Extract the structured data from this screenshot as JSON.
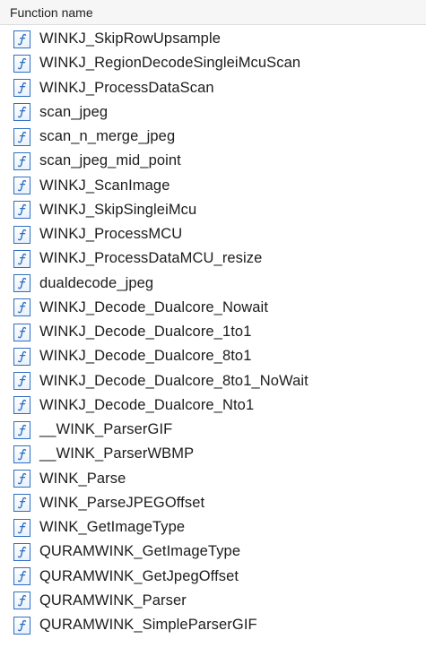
{
  "header": {
    "title": "Function name"
  },
  "functions": [
    {
      "name": "WINKJ_SkipRowUpsample"
    },
    {
      "name": "WINKJ_RegionDecodeSingleiMcuScan"
    },
    {
      "name": "WINKJ_ProcessDataScan"
    },
    {
      "name": "scan_jpeg"
    },
    {
      "name": "scan_n_merge_jpeg"
    },
    {
      "name": "scan_jpeg_mid_point"
    },
    {
      "name": "WINKJ_ScanImage"
    },
    {
      "name": "WINKJ_SkipSingleiMcu"
    },
    {
      "name": "WINKJ_ProcessMCU"
    },
    {
      "name": "WINKJ_ProcessDataMCU_resize"
    },
    {
      "name": "dualdecode_jpeg"
    },
    {
      "name": "WINKJ_Decode_Dualcore_Nowait"
    },
    {
      "name": "WINKJ_Decode_Dualcore_1to1"
    },
    {
      "name": "WINKJ_Decode_Dualcore_8to1"
    },
    {
      "name": "WINKJ_Decode_Dualcore_8to1_NoWait"
    },
    {
      "name": "WINKJ_Decode_Dualcore_Nto1"
    },
    {
      "name": "__WINK_ParserGIF"
    },
    {
      "name": "__WINK_ParserWBMP"
    },
    {
      "name": "WINK_Parse"
    },
    {
      "name": "WINK_ParseJPEGOffset"
    },
    {
      "name": "WINK_GetImageType"
    },
    {
      "name": "QURAMWINK_GetImageType"
    },
    {
      "name": "QURAMWINK_GetJpegOffset"
    },
    {
      "name": "QURAMWINK_Parser"
    },
    {
      "name": "QURAMWINK_SimpleParserGIF"
    }
  ],
  "icons": {
    "function": "function-icon"
  },
  "colors": {
    "icon_border": "#2e6fc4",
    "icon_glyph": "#2e6fc4",
    "header_bg": "#f6f6f6"
  }
}
